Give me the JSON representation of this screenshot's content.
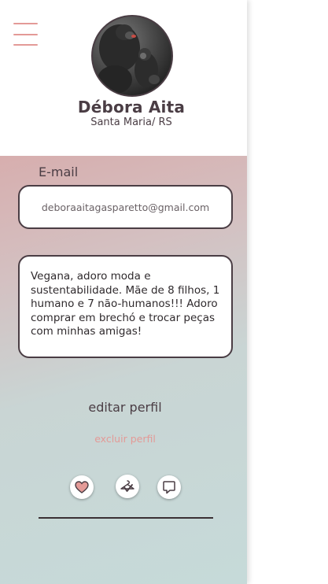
{
  "profile": {
    "name": "Débora Aita",
    "location": "Santa Maria/ RS",
    "avatar_icon": "profile-photo"
  },
  "form": {
    "email_label": "E-mail",
    "email_value": "deboraaitagasparetto@gmail.com",
    "bio_value": "Vegana, adoro moda e sustentabilidade. Mãe de 8 filhos, 1 humano e 7 não-humanos!!! Adoro comprar em brechó e trocar peças com minhas amigas!"
  },
  "actions": {
    "edit_label": "editar perfil",
    "delete_label": "excluir perfil"
  },
  "nav": {
    "icons": [
      "heart-icon",
      "hanger-icon",
      "chat-icon"
    ]
  },
  "colors": {
    "accent": "#e39a97",
    "text_dark": "#4a3d44",
    "gradient_top": "#d7aeae",
    "gradient_bottom": "#c6dad9"
  }
}
